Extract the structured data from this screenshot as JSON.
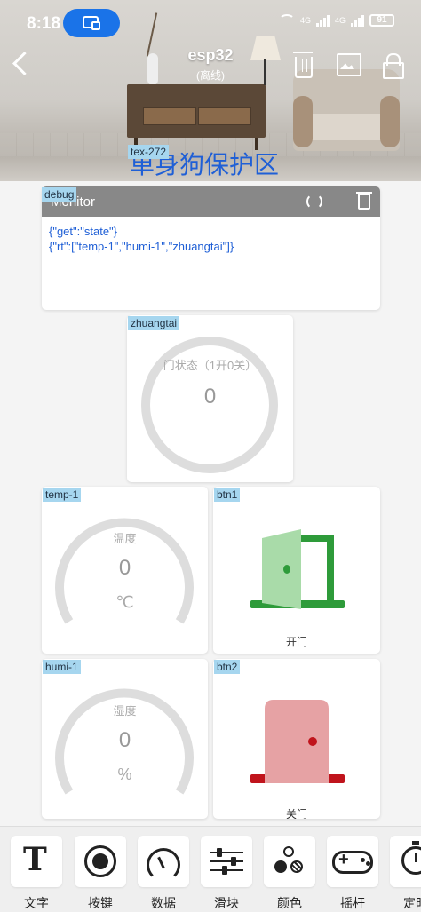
{
  "status_bar": {
    "time": "8:18",
    "signal1": "4G",
    "signal2": "4G",
    "battery": "91"
  },
  "header": {
    "device_name": "esp32",
    "device_status": "(离线)",
    "text_widget_tag": "tex-272",
    "text_widget_value": "单身狗保护区"
  },
  "monitor": {
    "tag": "debug",
    "title": "Monitor",
    "lines": [
      "{\"get\":\"state\"}",
      "{\"rt\":[\"temp-1\",\"humi-1\",\"zhuangtai\"]}"
    ]
  },
  "widgets": {
    "zhuangtai": {
      "tag": "zhuangtai",
      "label": "门状态（1开0关）",
      "value": "0"
    },
    "temp": {
      "tag": "temp-1",
      "label": "温度",
      "value": "0",
      "unit": "℃"
    },
    "humi": {
      "tag": "humi-1",
      "label": "湿度",
      "value": "0",
      "unit": "%"
    },
    "btn1": {
      "tag": "btn1",
      "label": "开门"
    },
    "btn2": {
      "tag": "btn2",
      "label": "关门"
    }
  },
  "toolbar": {
    "items": [
      {
        "label": "文字",
        "icon": "text-icon"
      },
      {
        "label": "按键",
        "icon": "button-icon"
      },
      {
        "label": "数据",
        "icon": "gauge-icon"
      },
      {
        "label": "滑块",
        "icon": "slider-icon"
      },
      {
        "label": "颜色",
        "icon": "color-icon"
      },
      {
        "label": "摇杆",
        "icon": "joystick-icon"
      },
      {
        "label": "定时",
        "icon": "timer-icon"
      }
    ]
  },
  "colors": {
    "accent": "#1a73e8",
    "door_open_green": "#2e9b3a",
    "door_close_red": "#c0141c",
    "gauge_track": "#dddddd",
    "tag_bg": "#a6d6ef"
  }
}
